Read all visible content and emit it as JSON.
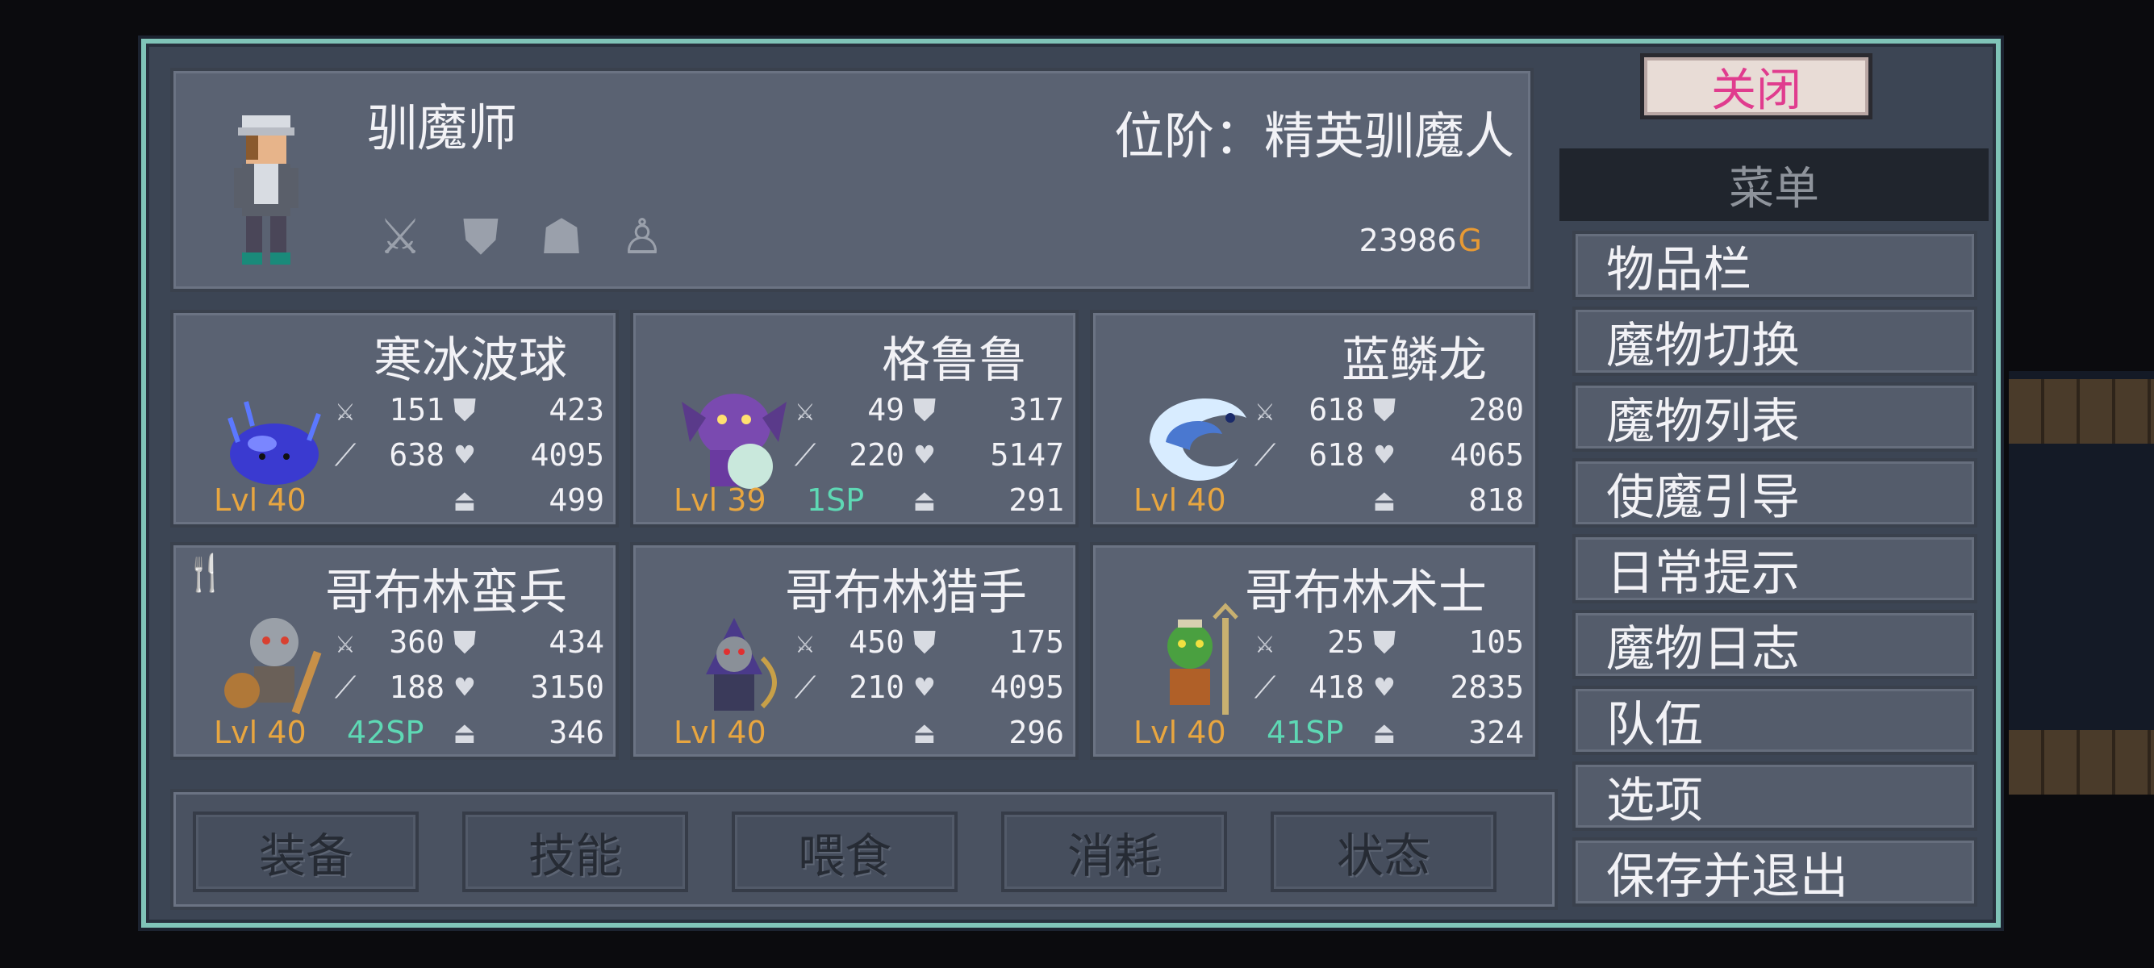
{
  "header": {
    "name": "驯魔师",
    "rank": "位阶：精英驯魔人",
    "gold_value": "23986",
    "gold_unit": "G"
  },
  "monsters": [
    {
      "name": "寒冰波球",
      "atk": "151",
      "def": "423",
      "matk": "638",
      "hp": "4095",
      "wt": "499",
      "level": "Lvl 40",
      "sp": ""
    },
    {
      "name": "格鲁鲁",
      "atk": "49",
      "def": "317",
      "matk": "220",
      "hp": "5147",
      "wt": "291",
      "level": "Lvl 39",
      "sp": "1SP"
    },
    {
      "name": "蓝鳞龙",
      "atk": "618",
      "def": "280",
      "matk": "618",
      "hp": "4065",
      "wt": "818",
      "level": "Lvl 40",
      "sp": ""
    },
    {
      "name": "哥布林蛮兵",
      "atk": "360",
      "def": "434",
      "matk": "188",
      "hp": "3150",
      "wt": "346",
      "level": "Lvl 40",
      "sp": "42SP"
    },
    {
      "name": "哥布林猎手",
      "atk": "450",
      "def": "175",
      "matk": "210",
      "hp": "4095",
      "wt": "296",
      "level": "Lvl 40",
      "sp": ""
    },
    {
      "name": "哥布林术士",
      "atk": "25",
      "def": "105",
      "matk": "418",
      "hp": "2835",
      "wt": "324",
      "level": "Lvl 40",
      "sp": "41SP"
    }
  ],
  "tabs": [
    "装备",
    "技能",
    "喂食",
    "消耗",
    "状态"
  ],
  "close_label": "关闭",
  "menu": {
    "title": "菜单",
    "items": [
      "物品栏",
      "魔物切换",
      "魔物列表",
      "使魔引导",
      "日常提示",
      "魔物日志",
      "队伍",
      "选项",
      "保存并退出"
    ]
  },
  "colors": {
    "frame": "#80c4b8",
    "level": "#e8a640",
    "sp": "#5ed8b4",
    "gold": "#e89a34",
    "close_text": "#e03c8e"
  }
}
